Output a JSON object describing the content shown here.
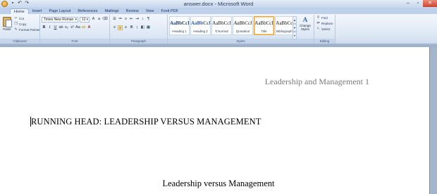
{
  "window": {
    "title": "answer.docx - Microsoft Word",
    "minimize": "–",
    "maximize": "▫",
    "close": "✕"
  },
  "tabs": [
    "Home",
    "Insert",
    "Page Layout",
    "References",
    "Mailings",
    "Review",
    "View",
    "Foxit PDF"
  ],
  "clipboard": {
    "paste_label": "Paste",
    "cut_label": "Cut",
    "copy_label": "Copy",
    "format_painter_label": "Format Painter",
    "group_label": "Clipboard"
  },
  "font": {
    "family": "Times New Roman",
    "size": "12",
    "group_label": "Font"
  },
  "paragraph": {
    "group_label": "Paragraph"
  },
  "styles": {
    "group_label": "Styles",
    "sample": "AaBbCcI",
    "items": [
      {
        "name": "Heading 1",
        "selected": false
      },
      {
        "name": "Heading 2",
        "selected": false
      },
      {
        "name": "¶ Normal",
        "selected": false
      },
      {
        "name": "Quotation",
        "selected": false
      },
      {
        "name": "Title",
        "selected": true
      },
      {
        "name": "Bibliography",
        "selected": false
      }
    ],
    "change_styles_label": "Change Styles"
  },
  "editing": {
    "group_label": "Editing",
    "find_label": "Find",
    "replace_label": "Replace",
    "select_label": "Select"
  },
  "document": {
    "header": "Leadership and Management 1",
    "running_head": "RUNNING HEAD: LEADERSHIP  VERSUS MANAGEMENT",
    "title": "Leadership versus Management"
  },
  "colors": {
    "ribbon": "#dde8f5",
    "accent": "#e9a13b"
  }
}
